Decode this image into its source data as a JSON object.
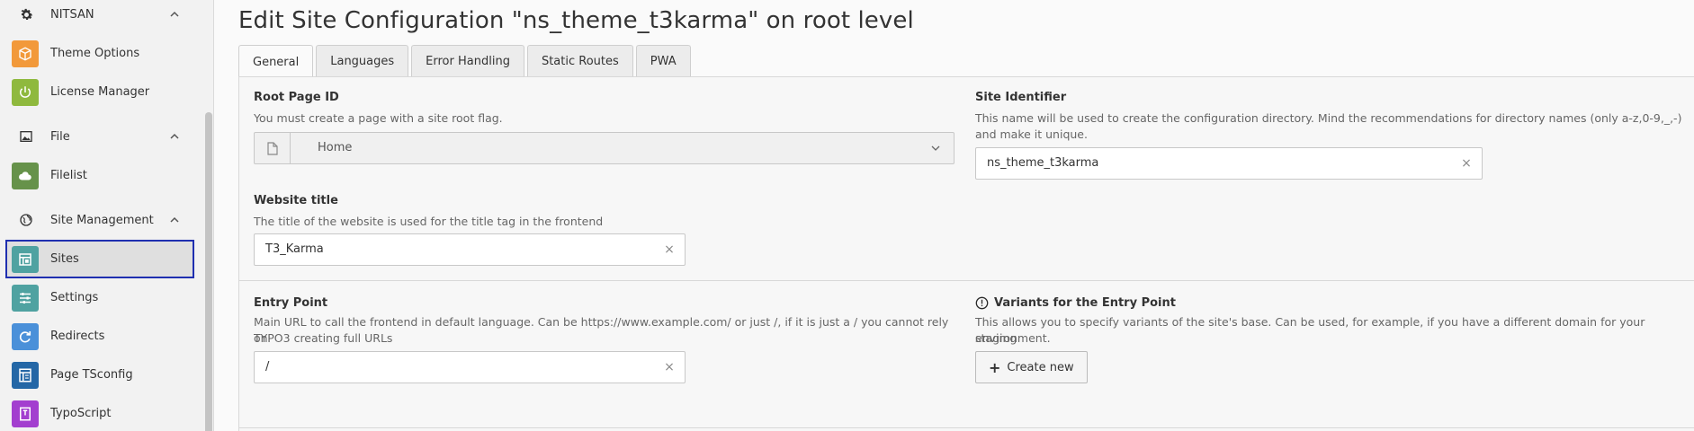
{
  "sidebar": {
    "groups": [
      {
        "label": "NITSAN",
        "icon": "gear-icon"
      },
      {
        "label": "File",
        "icon": "image-icon"
      },
      {
        "label": "Site Management",
        "icon": "globe-icon"
      }
    ],
    "items": [
      {
        "label": "Theme Options",
        "icon": "box-icon",
        "color": "#f2993a"
      },
      {
        "label": "License Manager",
        "icon": "power-icon",
        "color": "#8fb93e"
      },
      {
        "label": "Filelist",
        "icon": "cloud-icon",
        "color": "#66924a"
      },
      {
        "label": "Sites",
        "icon": "site-icon",
        "color": "#4fa2a1"
      },
      {
        "label": "Settings",
        "icon": "sliders-icon",
        "color": "#4fa2a1"
      },
      {
        "label": "Redirects",
        "icon": "redirect-icon",
        "color": "#4a90d9"
      },
      {
        "label": "Page TSconfig",
        "icon": "tsconfig-icon",
        "color": "#2467a6"
      },
      {
        "label": "TypoScript",
        "icon": "typoscript-icon",
        "color": "#a33fcf"
      }
    ]
  },
  "main": {
    "title": "Edit Site Configuration \"ns_theme_t3karma\" on root level",
    "tabs": [
      "General",
      "Languages",
      "Error Handling",
      "Static Routes",
      "PWA"
    ],
    "fields": {
      "root_page": {
        "label": "Root Page ID",
        "desc": "You must create a page with a site root flag.",
        "value": "Home"
      },
      "site_identifier": {
        "label": "Site Identifier",
        "desc1": "This name will be used to create the configuration directory. Mind the recommendations for directory names (only a-z,0-9,_,-)",
        "desc2": "and make it unique.",
        "value": "ns_theme_t3karma"
      },
      "website_title": {
        "label": "Website title",
        "desc": "The title of the website is used for the title tag in the frontend",
        "value": "T3_Karma"
      },
      "entry_point": {
        "label": "Entry Point",
        "desc1": "Main URL to call the frontend in default language. Can be https://www.example.com/ or just /, if it is just a / you cannot rely on",
        "desc2": "TYPO3 creating full URLs",
        "value": "/"
      },
      "variants": {
        "label": "Variants for the Entry Point",
        "desc1": "This allows you to specify variants of the site's base. Can be used, for example, if you have a different domain for your staging",
        "desc2": "environment.",
        "button": "Create new"
      }
    },
    "clear_glyph": "×"
  },
  "colors": {
    "active_border": "#1f2fb0"
  }
}
